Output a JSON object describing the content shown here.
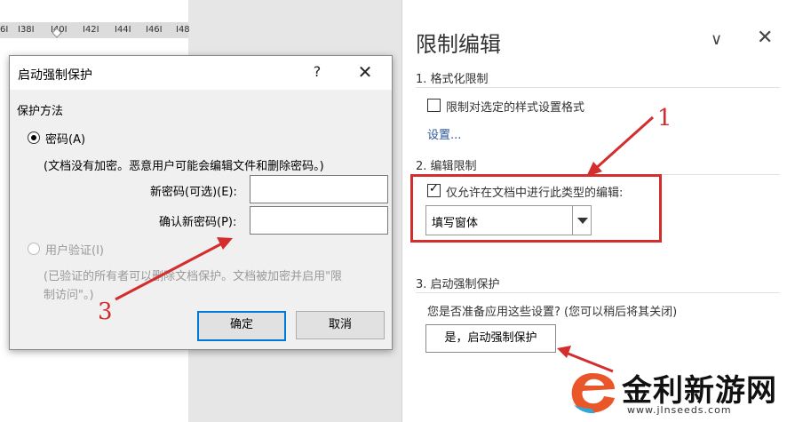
{
  "ruler": {
    "ticks": [
      "6I",
      "I38I",
      "I40I",
      "I42I",
      "I44I",
      "I46I",
      "I48"
    ]
  },
  "dialog": {
    "title": "启动强制保护",
    "help_label": "?",
    "close_label": "✕",
    "section_label": "保护方法",
    "password_option": "密码(A)",
    "password_note": "(文档没有加密。恶意用户可能会编辑文件和删除密码。)",
    "new_password_label": "新密码(可选)(E):",
    "new_password_value": "",
    "confirm_password_label": "确认新密码(P):",
    "confirm_password_value": "",
    "user_auth_option": "用户验证(I)",
    "user_auth_note_line1": "(已验证的所有者可以删除文档保护。文档被加密并启用\"限",
    "user_auth_note_line2": "制访问\"。)",
    "ok_label": "确定",
    "cancel_label": "取消"
  },
  "panel": {
    "title": "限制编辑",
    "collapse_icon": "chevron-down-icon",
    "close_icon": "close-icon",
    "collapse_label": "∨",
    "close_label": "✕",
    "section1_heading": "1. 格式化限制",
    "section1_checkbox_label": "限制对选定的样式设置格式",
    "section1_checkbox_checked": false,
    "settings_link": "设置...",
    "section2_heading": "2. 编辑限制",
    "section2_checkbox_label": "仅允许在文档中进行此类型的编辑:",
    "section2_checkbox_checked": true,
    "edit_type_value": "填写窗体",
    "section3_heading": "3. 启动强制保护",
    "section3_question": "您是否准备应用这些设置? (您可以稍后将其关闭)",
    "start_button_label": "是，启动强制保护"
  },
  "annotations": {
    "color": "#d32d2d",
    "num1": "1",
    "num3": "3"
  },
  "watermark": {
    "name": "金利新游网",
    "url": "www.jlnseeds.com"
  }
}
